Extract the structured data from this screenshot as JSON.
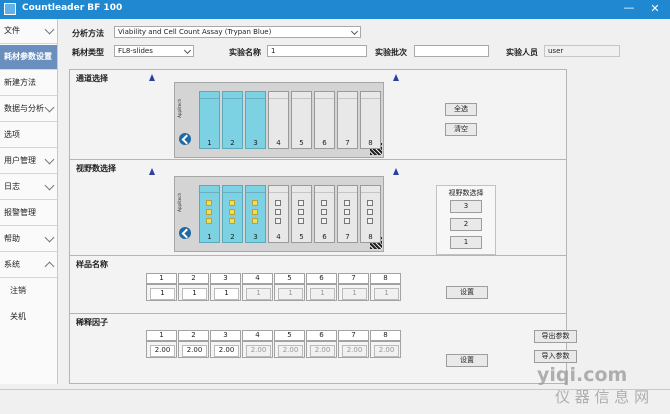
{
  "window": {
    "title": "Countleader BF 100"
  },
  "sidebar": [
    {
      "label": "文件",
      "chevron": "down"
    },
    {
      "label": "耗材参数设置",
      "active": true
    },
    {
      "label": "新建方法"
    },
    {
      "label": "数据与分析",
      "chevron": "down"
    },
    {
      "label": "选项"
    },
    {
      "label": "用户管理",
      "chevron": "down"
    },
    {
      "label": "日志",
      "chevron": "down"
    },
    {
      "label": "报警管理"
    },
    {
      "label": "帮助",
      "chevron": "down"
    },
    {
      "label": "系统",
      "chevron": "up"
    },
    {
      "label": "注销",
      "sub": true
    },
    {
      "label": "关机",
      "sub": true
    }
  ],
  "form": {
    "method_label": "分析方法",
    "method_value": "Viability and Cell Count Assay (Trypan Blue)",
    "consumable_label": "耗材类型",
    "consumable_value": "FL8-slides",
    "exp_name_label": "实验名称",
    "exp_name_value": "1",
    "exp_batch_label": "实验批次",
    "exp_batch_value": "",
    "operator_label": "实验人员",
    "operator_value": "user"
  },
  "channel_section": {
    "title": "通道选择",
    "wells": [
      {
        "num": "1",
        "selected": true
      },
      {
        "num": "2",
        "selected": true
      },
      {
        "num": "3",
        "selected": true
      },
      {
        "num": "4",
        "selected": false
      },
      {
        "num": "5",
        "selected": false
      },
      {
        "num": "6",
        "selected": false
      },
      {
        "num": "7",
        "selected": false
      },
      {
        "num": "8",
        "selected": false
      }
    ],
    "select_all_label": "全选",
    "clear_label": "清空",
    "brand": "Applitech"
  },
  "fov_section": {
    "title": "视野数选择",
    "box_title": "视野数选择",
    "options": [
      "3",
      "2",
      "1"
    ],
    "wells": [
      {
        "num": "1",
        "selected": true
      },
      {
        "num": "2",
        "selected": true
      },
      {
        "num": "3",
        "selected": true
      },
      {
        "num": "4",
        "selected": false
      },
      {
        "num": "5",
        "selected": false
      },
      {
        "num": "6",
        "selected": false
      },
      {
        "num": "7",
        "selected": false
      },
      {
        "num": "8",
        "selected": false
      }
    ],
    "fields_per_well": 3
  },
  "sample_section": {
    "title": "样品名称",
    "headers": [
      "1",
      "2",
      "3",
      "4",
      "5",
      "6",
      "7",
      "8"
    ],
    "values": [
      "1",
      "1",
      "1",
      "1",
      "1",
      "1",
      "1",
      "1"
    ],
    "enabled": [
      true,
      true,
      true,
      false,
      false,
      false,
      false,
      false
    ],
    "set_label": "设置"
  },
  "dilution_section": {
    "title": "稀释因子",
    "headers": [
      "1",
      "2",
      "3",
      "4",
      "5",
      "6",
      "7",
      "8"
    ],
    "values": [
      "2.00",
      "2.00",
      "2.00",
      "2.00",
      "2.00",
      "2.00",
      "2.00",
      "2.00"
    ],
    "enabled": [
      true,
      true,
      true,
      false,
      false,
      false,
      false,
      false
    ],
    "set_label": "设置"
  },
  "export_label": "导出参数",
  "import_label": "导入参数",
  "watermark": {
    "line1": "yiqi.com",
    "line2": "仪 器 信 息 网"
  }
}
